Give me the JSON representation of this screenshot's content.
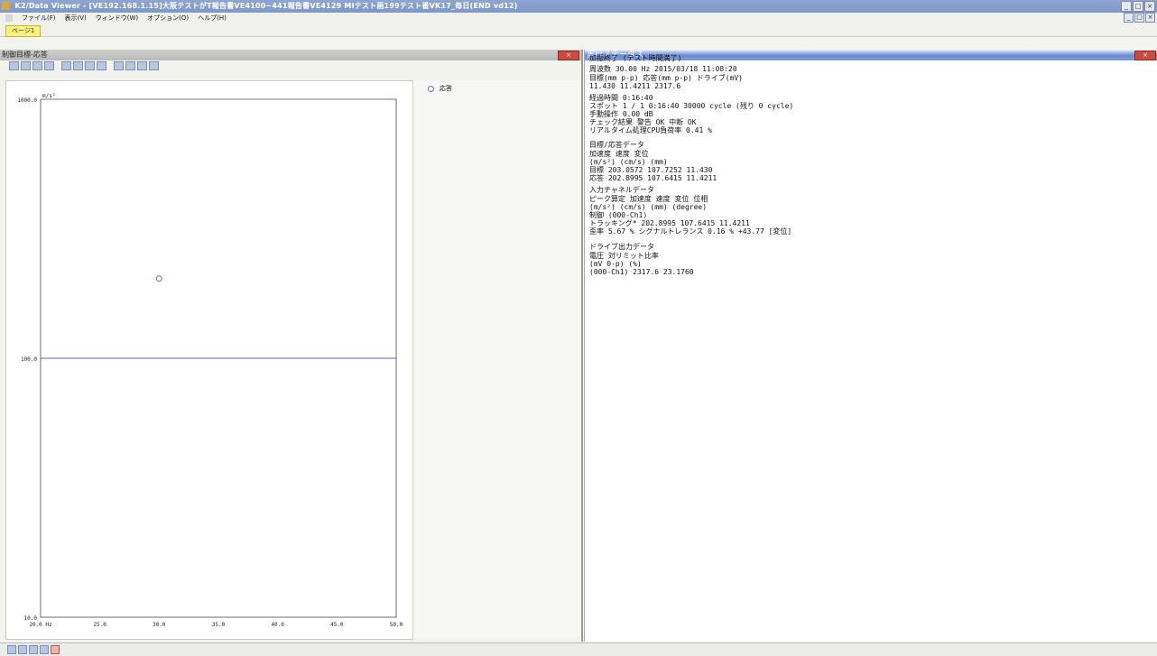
{
  "window": {
    "title": "K2/Data Viewer - [VE192.168.1.15]大阪テストがT報告書VE4100~441報告書VE4129 MIテスト画199テスト番VK17_毎日(END vd12)"
  },
  "menu": {
    "items": [
      "ファイル(F)",
      "表示(V)",
      "ウィンドウ(W)",
      "オプション(O)",
      "ヘルプ(H)"
    ]
  },
  "tabs": {
    "page1": "ページ1"
  },
  "left_pane": {
    "title": "制御目標-応答",
    "close": "×",
    "legend": {
      "series": "応答"
    }
  },
  "chart_data": {
    "type": "line",
    "title": "",
    "xlabel": "Hz",
    "ylabel": "m/s²",
    "x_scale": "linear",
    "y_scale": "log",
    "xlim": [
      20.0,
      50.0
    ],
    "ylim": [
      10.0,
      1000.0
    ],
    "x_ticks": [
      "20.0 Hz",
      "25.0",
      "30.0",
      "35.0",
      "40.0",
      "45.0",
      "50.0"
    ],
    "y_ticks": [
      "1000.0",
      "100.0",
      "10.0"
    ],
    "y_unit_label": "m/s²",
    "series": [
      {
        "name": "応答",
        "points": [
          {
            "x": 30.0,
            "y": 202.8995
          }
        ],
        "color": "#6070c0"
      }
    ],
    "target_line": {
      "y": 100.0,
      "color": "#5860b8"
    },
    "grid": true
  },
  "right_pane": {
    "title": "実行ステータス",
    "close": "×",
    "lines": [
      "加振終了 (テスト時間満了)",
      "周波数  30.00 Hz              2015/03/18 11:08:20",
      "目標(mm p-p)      応答(mm p-p)       ドライブ(mV)",
      "  11.430           11.4211           2317.6",
      "経過時間 0:16:40",
      "スポット 1 / 1          0:16:40        30000 cycle       (残り 0 cycle)",
      "手動操作  0.00 dB",
      "チェック結果              警告    OK       中断     OK",
      "リアルタイム処理CPU負荷率   0.41 %",
      "目標/応答データ",
      "             加速度               速度                変位",
      "             (m/s²)              (cm/s)              (mm)",
      "  目標   203.0572             107.7252            11.430",
      "  応答   202.8995             107.6415            11.4211",
      "入力チャネルデータ",
      "   ピーク算定            加速度              速度              変位              位相",
      "                         (m/s²)             (cm/s)             (mm)             (degree)",
      "   制御 (000-Ch1)",
      "           トラッキング*  202.8995            107.6415          11.4211",
      "           歪率              5.67 %            シグナルトレランス  0.16 %          +43.77  [変位]",
      "ドライブ出力データ",
      "                              電圧               対リミット比率",
      "                             (mV 0-p)               (%)",
      "   (000-Ch1)              2317.6              23.1760"
    ]
  }
}
